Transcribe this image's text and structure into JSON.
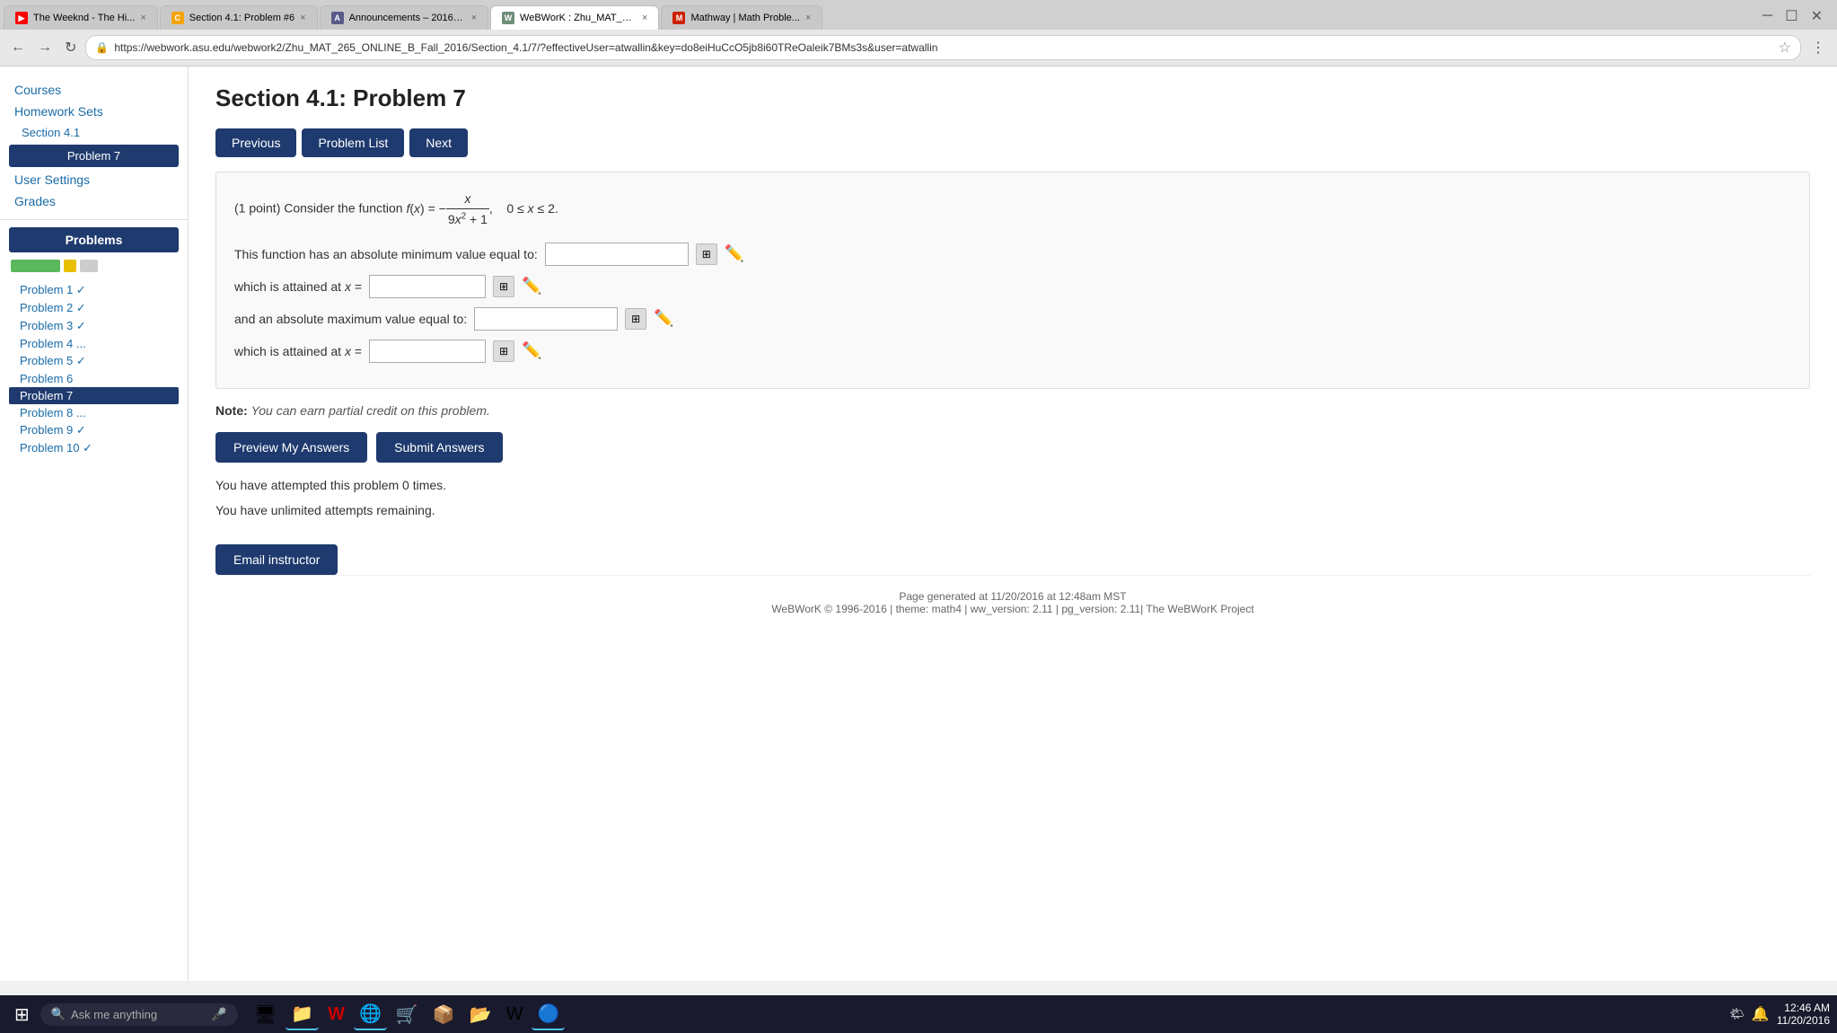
{
  "browser": {
    "tabs": [
      {
        "id": "tab1",
        "favicon_color": "#ff0000",
        "favicon_text": "▶",
        "title": "The Weeknd - The Hi...",
        "active": false
      },
      {
        "id": "tab2",
        "favicon_color": "#f4a40a",
        "favicon_text": "C",
        "title": "Section 4.1: Problem #6",
        "active": false
      },
      {
        "id": "tab3",
        "favicon_color": "#5a5a8a",
        "favicon_text": "A",
        "title": "Announcements – 2016F...",
        "active": false
      },
      {
        "id": "tab4",
        "favicon_color": "#6e8e7a",
        "favicon_text": "W",
        "title": "WeBWorK : Zhu_MAT_26...",
        "active": true
      },
      {
        "id": "tab5",
        "favicon_color": "#cc2200",
        "favicon_text": "M",
        "title": "Mathway | Math Proble...",
        "active": false
      }
    ],
    "url": "https://webwork.asu.edu/webwork2/Zhu_MAT_265_ONLINE_B_Fall_2016/Section_4.1/7/?effectiveUser=atwallin&key=do8eiHuCcO5jb8i60TReOaleik7BMs3s&user=atwallin"
  },
  "sidebar": {
    "links": [
      {
        "label": "Courses",
        "id": "courses"
      },
      {
        "label": "Homework Sets",
        "id": "homework-sets"
      },
      {
        "label": "Section 4.1",
        "id": "section-4-1"
      },
      {
        "label": "User Settings",
        "id": "user-settings"
      },
      {
        "label": "Grades",
        "id": "grades"
      }
    ],
    "active_item": "Problem 7",
    "problems_header": "Problems",
    "problems": [
      {
        "label": "Problem 1 ✓",
        "id": "p1",
        "active": false
      },
      {
        "label": "Problem 2 ✓",
        "id": "p2",
        "active": false
      },
      {
        "label": "Problem 3 ✓",
        "id": "p3",
        "active": false
      },
      {
        "label": "Problem 4 ...",
        "id": "p4",
        "active": false
      },
      {
        "label": "Problem 5 ✓",
        "id": "p5",
        "active": false
      },
      {
        "label": "Problem 6",
        "id": "p6",
        "active": false
      },
      {
        "label": "Problem 7",
        "id": "p7",
        "active": true
      },
      {
        "label": "Problem 8 ...",
        "id": "p8",
        "active": false
      },
      {
        "label": "Problem 9 ✓",
        "id": "p9",
        "active": false
      },
      {
        "label": "Problem 10 ✓",
        "id": "p10",
        "active": false
      }
    ]
  },
  "content": {
    "title": "Section 4.1: Problem 7",
    "buttons": {
      "previous": "Previous",
      "problem_list": "Problem List",
      "next": "Next"
    },
    "problem": {
      "points": "(1 point)",
      "description": "Consider the function",
      "formula_text": "f(x) = −x / (9x² + 1),   0 ≤ x ≤ 2.",
      "fields": [
        {
          "label": "This function has an absolute minimum value equal to:",
          "input_value": "",
          "id": "min-value"
        },
        {
          "label": "which is attained at x =",
          "input_value": "",
          "id": "min-x"
        },
        {
          "label": "and an absolute maximum value equal to:",
          "input_value": "",
          "id": "max-value"
        },
        {
          "label": "which is attained at x =",
          "input_value": "",
          "id": "max-x"
        }
      ]
    },
    "note": "Note: You can earn partial credit on this problem.",
    "action_buttons": {
      "preview": "Preview My Answers",
      "submit": "Submit Answers"
    },
    "attempt_info": [
      "You have attempted this problem 0 times.",
      "You have unlimited attempts remaining."
    ],
    "email_button": "Email instructor"
  },
  "footer": {
    "line1": "Page generated at 11/20/2016 at 12:48am MST",
    "line2": "WeBWorK © 1996-2016 | theme: math4 | ww_version: 2.11 | pg_version: 2.11| The WeBWorK Project"
  },
  "taskbar": {
    "search_placeholder": "Ask me anything",
    "time": "12:46 AM",
    "date": "11/20/2016",
    "icons": [
      "🖥",
      "📁",
      "🏆",
      "🌐",
      "🛒",
      "📦",
      "W",
      "🌀"
    ]
  }
}
